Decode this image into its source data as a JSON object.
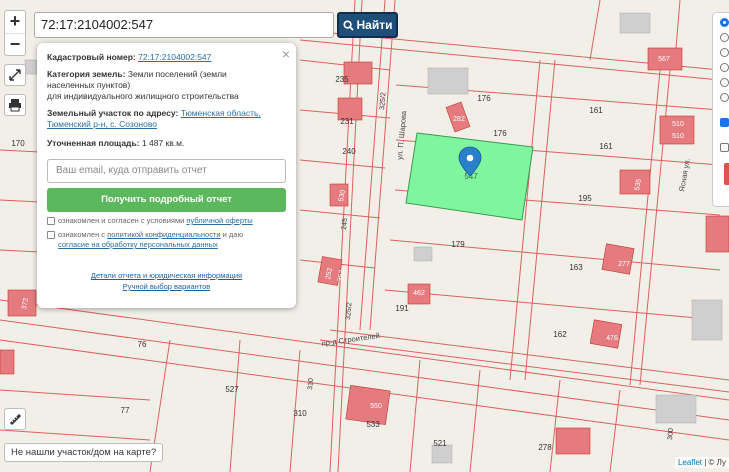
{
  "search": {
    "value": "72:17:2104002:547",
    "button_label": "Найти"
  },
  "zoom": {
    "in": "+",
    "out": "−"
  },
  "popup": {
    "cadastral_label": "Кадастровый номер:",
    "cadastral_value": "72:17:2104002:547",
    "category_label": "Категория земель:",
    "category_value_1": "Земли поселений (земли",
    "category_value_2": "населенных пунктов)",
    "category_value_3": "для индивидуального жилищного строительства",
    "address_label": "Земельный участок по адресу:",
    "address_value_1": "Тюменская область,",
    "address_value_2": "Тюменский р-н, с. Созоново",
    "area_label": "Уточненная площадь:",
    "area_value": "1 487 кв.м.",
    "email_placeholder": "Ваш email, куда отправить отчет",
    "get_button": "Получить подробный отчет",
    "agree1_a": "ознакомлен и согласен с условиями ",
    "agree1_link": "публичной оферты",
    "agree2_a": "ознакомлен с ",
    "agree2_link": "политикой конфиденциальности",
    "agree2_b": " и даю",
    "agree2_link2": "согласие на обработку персональных данных",
    "details_link": "Детали отчета и юридическая информация",
    "manual_link": "Ручной выбор вариантов",
    "close": "×"
  },
  "not_found": "Не нашли участок/дом на карте?",
  "attribution": {
    "leaflet": "Leaflet",
    "rest": " | © Лу"
  },
  "colors": {
    "parcel_selected": "#7ff59f",
    "building": "#e57b7f",
    "parcel_line": "#d9534f",
    "marker": "#2a81cb"
  },
  "map_labels": {
    "parcel_numbers": [
      "176",
      "176",
      "161",
      "161",
      "195",
      "179",
      "163",
      "191",
      "162",
      "235",
      "231",
      "240",
      "245",
      "170",
      "76",
      "527",
      "77",
      "310",
      "533",
      "521",
      "278",
      "300",
      "325/2",
      "325/2",
      "547"
    ],
    "building_numbers": [
      "282",
      "510",
      "510",
      "535",
      "277",
      "462",
      "476",
      "530",
      "252",
      "372",
      "550",
      "567",
      "352"
    ],
    "streets": [
      "ул. П. Шарова",
      "Ясная ул.",
      "пр-д Строителей"
    ]
  }
}
